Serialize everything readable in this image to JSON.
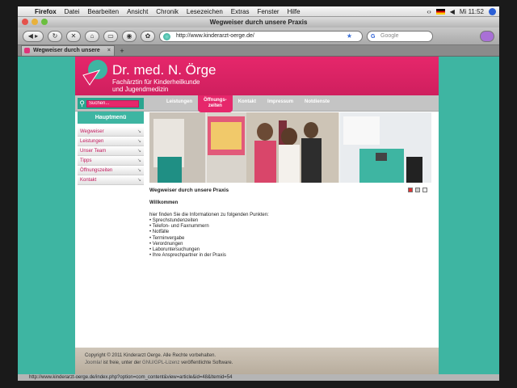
{
  "os_menubar": {
    "app": "Firefox",
    "items": [
      "Datei",
      "Bearbeiten",
      "Ansicht",
      "Chronik",
      "Lesezeichen",
      "Extras",
      "Fenster",
      "Hilfe"
    ],
    "clock": "Mi 11:52"
  },
  "window": {
    "title": "Wegweiser durch unsere Praxis",
    "url": "http://www.kinderarzt-oerge.de/",
    "search_placeholder": "Google",
    "tab_label": "Wegweiser durch unsere Praxis"
  },
  "site": {
    "title": "Dr. med. N. Örge",
    "subtitle_line1": "Fachärztin für Kinderheilkunde",
    "subtitle_line2": "und Jugendmedizin",
    "search_placeholder": "Suchen...",
    "nav": [
      {
        "label": "Leistungen",
        "active": false
      },
      {
        "label": "Öffnungs-\nzeiten",
        "active": true
      },
      {
        "label": "Kontakt",
        "active": false
      },
      {
        "label": "Impressum",
        "active": false
      },
      {
        "label": "Notdienste",
        "active": false
      }
    ],
    "menu_title": "Hauptmenü",
    "menu": [
      "Wegweiser",
      "Leistungen",
      "Unser Team",
      "Tipps",
      "Öffnungszeiten",
      "Kontakt"
    ],
    "article": {
      "title": "Wegweiser durch unsere Praxis",
      "heading": "Willkommen",
      "intro": "hier finden Sie die Informationen zu folgenden Punkten:",
      "points": [
        "• Sprechstundenzeiten",
        "• Telefon- und Faxnummern",
        "• Notfälle",
        "• Terminvergabe",
        "• Verordnungen",
        "• Laboruntersuchungen",
        "• Ihre Ansprechpartner in der Praxis"
      ]
    },
    "footer": {
      "line1": "Copyright © 2011 Kinderarzt Oerge. Alle Rechte vorbehalten.",
      "line2_a": "Joomla!",
      "line2_b": " ist freie, unter der ",
      "line2_c": "GNU/GPL-Lizenz",
      "line2_d": " veröffentlichte Software."
    }
  },
  "status_url": "http://www.kinderarzt-oerge.de/index.php?option=com_content&view=article&id=48&Itemid=54",
  "colors": {
    "brand_pink": "#e6276b",
    "teal": "#3eb5a2"
  }
}
